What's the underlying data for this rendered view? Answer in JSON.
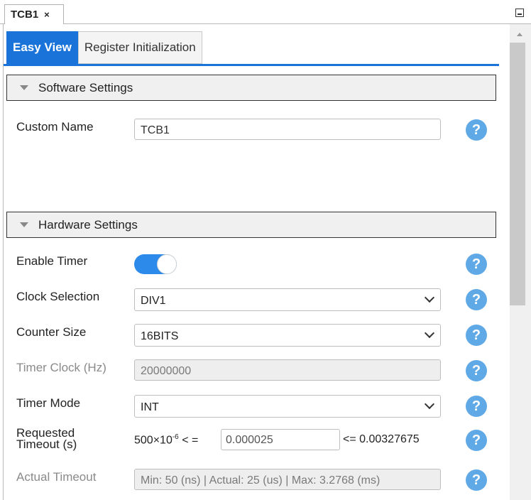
{
  "doc_tab": {
    "title": "TCB1",
    "close": "×"
  },
  "view_tabs": [
    {
      "label": "Easy View",
      "active": true
    },
    {
      "label": "Register Initialization",
      "active": false
    }
  ],
  "software_settings": {
    "title": "Software Settings",
    "custom_name": {
      "label": "Custom Name",
      "value": "TCB1"
    }
  },
  "hardware_settings": {
    "title": "Hardware Settings",
    "enable_timer": {
      "label": "Enable Timer",
      "on": true
    },
    "clock_selection": {
      "label": "Clock Selection",
      "value": "DIV1"
    },
    "counter_size": {
      "label": "Counter Size",
      "value": "16BITS"
    },
    "timer_clock": {
      "label": "Timer Clock (Hz)",
      "value": "20000000"
    },
    "timer_mode": {
      "label": "Timer Mode",
      "value": "INT"
    },
    "requested_timeout": {
      "label_line1": "Requested",
      "label_line2": "Timeout (s)",
      "min_base": "500×10",
      "min_exp": "-6",
      "le1": "< =",
      "value": "0.000025",
      "le2": "<=",
      "max": "0.00327675"
    },
    "actual_timeout": {
      "label": "Actual Timeout",
      "value": "Min: 50 (ns) | Actual: 25 (us) | Max: 3.2768 (ms)"
    }
  },
  "help_glyph": "?",
  "colors": {
    "accent": "#1a73d9",
    "toggle_on": "#2b8aea",
    "help": "#5fa9e6"
  }
}
